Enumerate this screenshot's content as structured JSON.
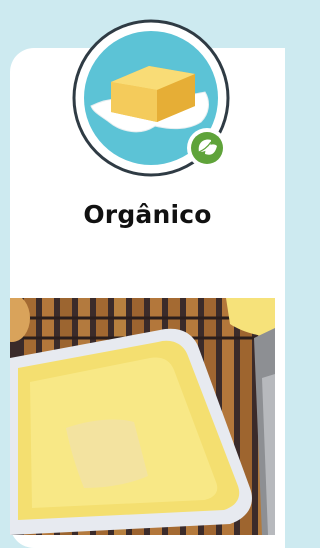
{
  "category": {
    "title": "Orgânico",
    "icon": "butter-icon",
    "badge_icon": "leaf-icon",
    "photo": "butter-in-tray-photo"
  },
  "colors": {
    "background": "#cdeaf0",
    "card": "#ffffff",
    "icon_circle": "#5cc3d6",
    "badge_green": "#5fa33a",
    "butter": "#f6d66b"
  }
}
